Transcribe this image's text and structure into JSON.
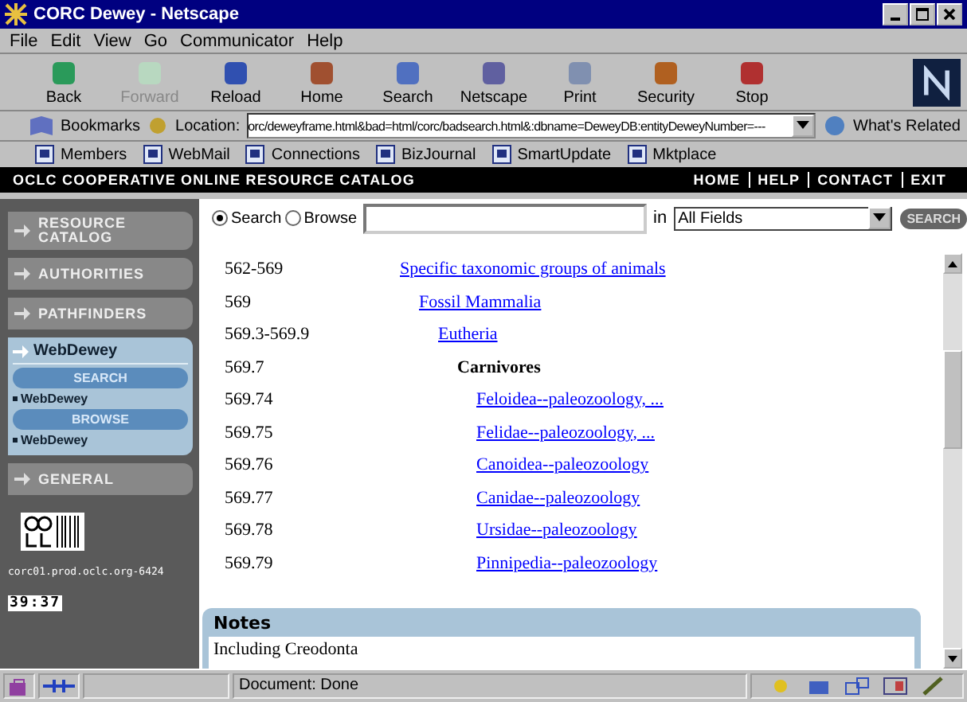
{
  "window": {
    "title": "CORC Dewey - Netscape"
  },
  "menu": [
    "File",
    "Edit",
    "View",
    "Go",
    "Communicator",
    "Help"
  ],
  "toolbar": [
    {
      "label": "Back",
      "disabled": false
    },
    {
      "label": "Forward",
      "disabled": true
    },
    {
      "label": "Reload",
      "disabled": false
    },
    {
      "label": "Home",
      "disabled": false
    },
    {
      "label": "Search",
      "disabled": false
    },
    {
      "label": "Netscape",
      "disabled": false
    },
    {
      "label": "Print",
      "disabled": false
    },
    {
      "label": "Security",
      "disabled": false
    },
    {
      "label": "Stop",
      "disabled": false
    }
  ],
  "location_bar": {
    "bookmarks": "Bookmarks",
    "label": "Location:",
    "url": "orc/deweyframe.html&bad=html/corc/badsearch.html&:dbname=DeweyDB:entityDeweyNumber=---",
    "related": "What's Related"
  },
  "personal_bar": [
    "Members",
    "WebMail",
    "Connections",
    "BizJournal",
    "SmartUpdate",
    "Mktplace"
  ],
  "site_header": {
    "title": "OCLC COOPERATIVE ONLINE RESOURCE CATALOG",
    "links": [
      "HOME",
      "HELP",
      "CONTACT",
      "EXIT"
    ]
  },
  "sidebar": {
    "buttons": [
      "RESOURCE CATALOG",
      "AUTHORITIES",
      "PATHFINDERS"
    ],
    "panel": {
      "title": "WebDewey",
      "sections": [
        {
          "button": "SEARCH",
          "item": "WebDewey"
        },
        {
          "button": "BROWSE",
          "item": "WebDewey"
        }
      ]
    },
    "bottom_button": "GENERAL",
    "host": "corc01.prod.oclc.org-6424",
    "clock": "39:37"
  },
  "search": {
    "modes": [
      {
        "label": "Search",
        "selected": true
      },
      {
        "label": "Browse",
        "selected": false
      }
    ],
    "in_label": "in",
    "field": "All Fields",
    "button": "SEARCH"
  },
  "entries": [
    {
      "number": "562-569",
      "title": "Specific taxonomic groups of animals",
      "kind": "link",
      "children": [
        {
          "number": "569",
          "title": "Fossil Mammalia",
          "kind": "link",
          "children": [
            {
              "number": "569.3-569.9",
              "title": "Eutheria",
              "kind": "link",
              "children": [
                {
                  "number": "569.7",
                  "title": "Carnivores",
                  "kind": "heading",
                  "children": [
                    {
                      "number": "569.74",
                      "title": "Feloidea--paleozoology, ...",
                      "kind": "link"
                    },
                    {
                      "number": "569.75",
                      "title": "Felidae--paleozoology, ...",
                      "kind": "link"
                    },
                    {
                      "number": "569.76",
                      "title": "Canoidea--paleozoology",
                      "kind": "link"
                    },
                    {
                      "number": "569.77",
                      "title": "Canidae--paleozoology",
                      "kind": "link"
                    },
                    {
                      "number": "569.78",
                      "title": "Ursidae--paleozoology",
                      "kind": "link"
                    },
                    {
                      "number": "569.79",
                      "title": "Pinnipedia--paleozoology",
                      "kind": "link"
                    }
                  ]
                }
              ]
            }
          ]
        }
      ]
    }
  ],
  "notes": {
    "title": "Notes",
    "text": "Including Creodonta"
  },
  "status_bar": {
    "text": "Document: Done"
  }
}
